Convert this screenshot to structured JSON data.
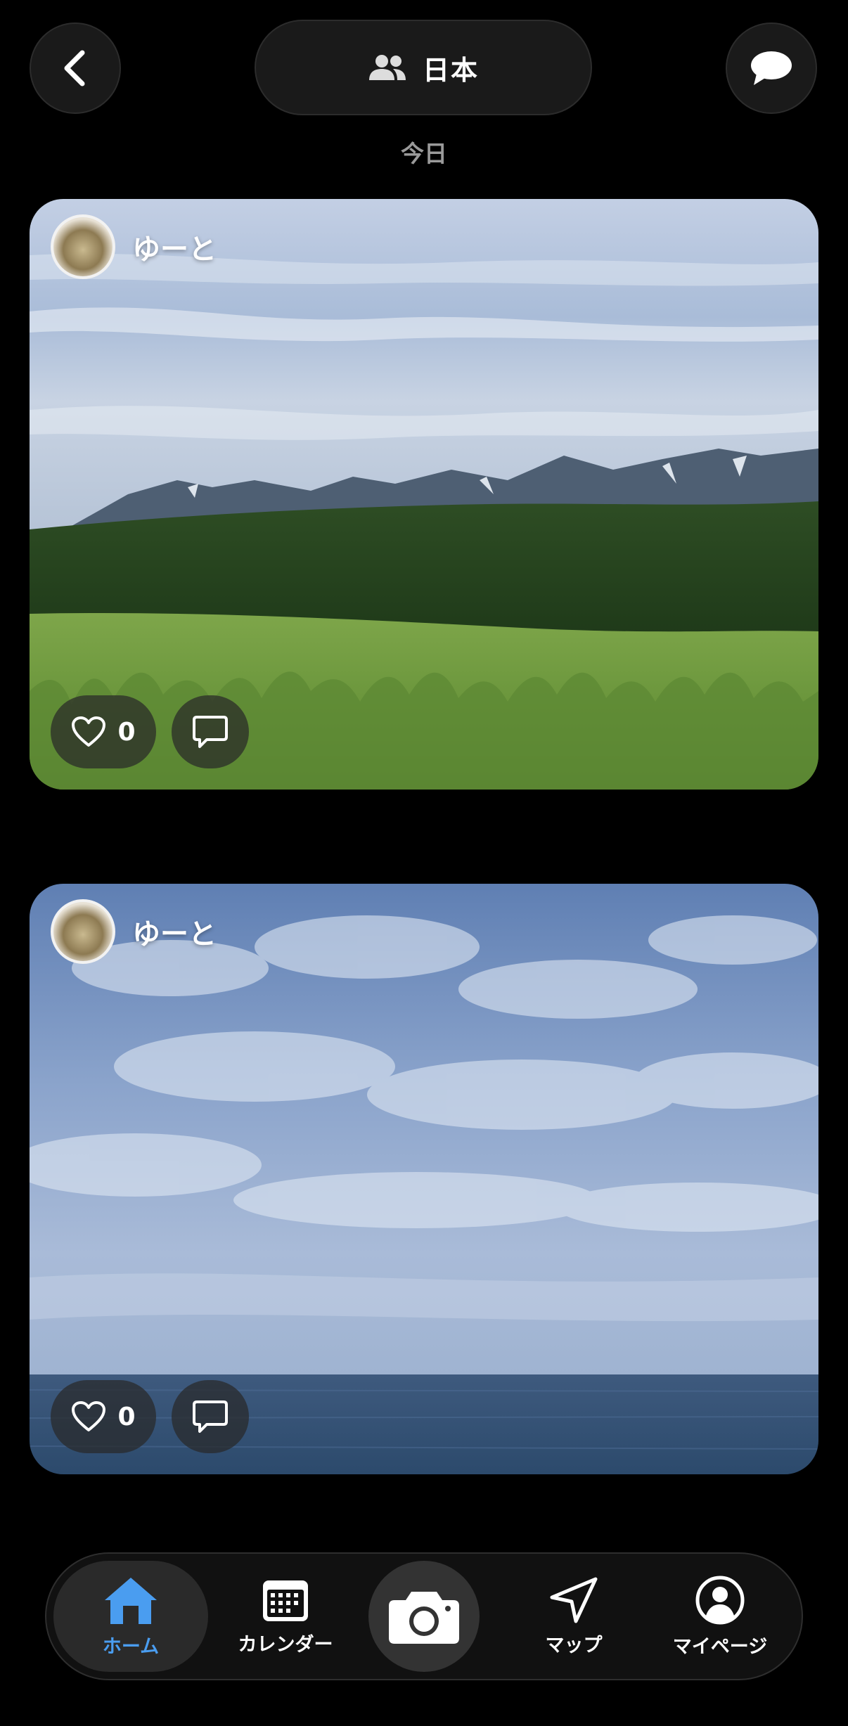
{
  "header": {
    "group_name": "日本",
    "group_icon": "people-icon",
    "back_icon": "chevron-left-icon",
    "chat_icon": "chat-bubble-icon"
  },
  "date_label": "今日",
  "posts": [
    {
      "author": "ゆーと",
      "likes": "0",
      "photo_subject": "mountains-forest-meadow"
    },
    {
      "author": "ゆーと",
      "likes": "0",
      "photo_subject": "sky-over-sea"
    }
  ],
  "tab_bar": {
    "items": [
      {
        "label": "ホーム",
        "icon": "home-icon",
        "active": true
      },
      {
        "label": "カレンダー",
        "icon": "calendar-icon",
        "active": false
      },
      {
        "label": "",
        "icon": "camera-icon",
        "active": false
      },
      {
        "label": "マップ",
        "icon": "navigation-arrow-icon",
        "active": false
      },
      {
        "label": "マイページ",
        "icon": "profile-icon",
        "active": false
      }
    ]
  },
  "colors": {
    "background": "#000000",
    "accent": "#4a9df0",
    "surface": "#1a1a1a"
  }
}
